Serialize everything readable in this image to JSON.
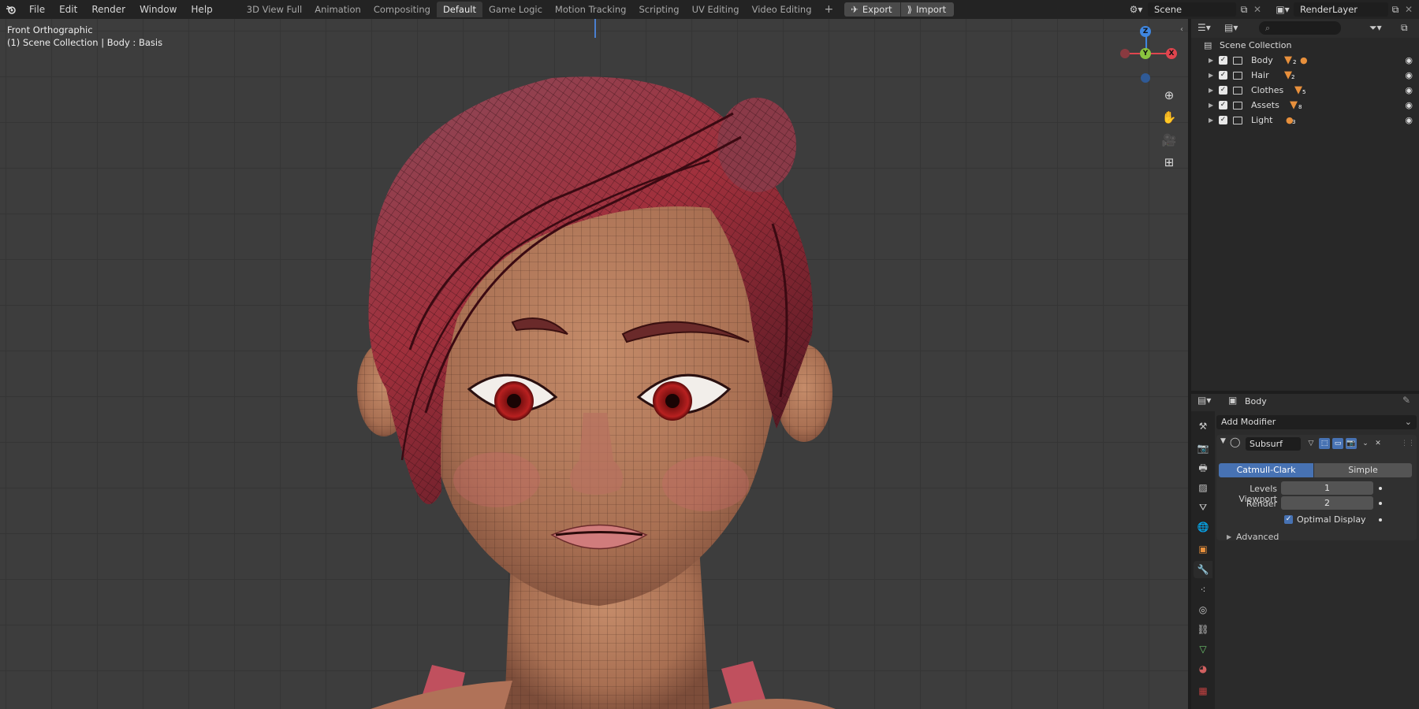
{
  "topbar": {
    "menu": [
      "File",
      "Edit",
      "Render",
      "Window",
      "Help"
    ],
    "tabs": [
      "3D View Full",
      "Animation",
      "Compositing",
      "Default",
      "Game Logic",
      "Motion Tracking",
      "Scripting",
      "UV Editing",
      "Video Editing"
    ],
    "active_tab": "Default",
    "export_label": "Export",
    "import_label": "Import",
    "scene": "Scene",
    "render_layer": "RenderLayer"
  },
  "viewport": {
    "view_name": "Front Orthographic",
    "context": "(1) Scene Collection | Body : Basis",
    "gizmo": {
      "z": "Z",
      "y": "Y",
      "x": "X"
    }
  },
  "outliner": {
    "root": "Scene Collection",
    "items": [
      {
        "name": "Body",
        "count": "2"
      },
      {
        "name": "Hair",
        "count": "2"
      },
      {
        "name": "Clothes",
        "count": "5"
      },
      {
        "name": "Assets",
        "count": "8"
      },
      {
        "name": "Light",
        "count": "3"
      }
    ]
  },
  "properties": {
    "object_name": "Body",
    "add_modifier": "Add Modifier",
    "modifier": {
      "name": "Subsurf",
      "mode_catmull": "Catmull-Clark",
      "mode_simple": "Simple",
      "levels_viewport_label": "Levels Viewport",
      "levels_viewport": "1",
      "render_label": "Render",
      "render": "2",
      "optimal_display": "Optimal Display",
      "optimal_display_checked": true
    },
    "advanced_label": "Advanced"
  },
  "colors": {
    "accent": "#4772b3",
    "skin": "#b8805e",
    "hair": "#7a2c3c",
    "gizmo_x": "#e0454e",
    "gizmo_y": "#8ac43f",
    "gizmo_z": "#3f86e0"
  }
}
